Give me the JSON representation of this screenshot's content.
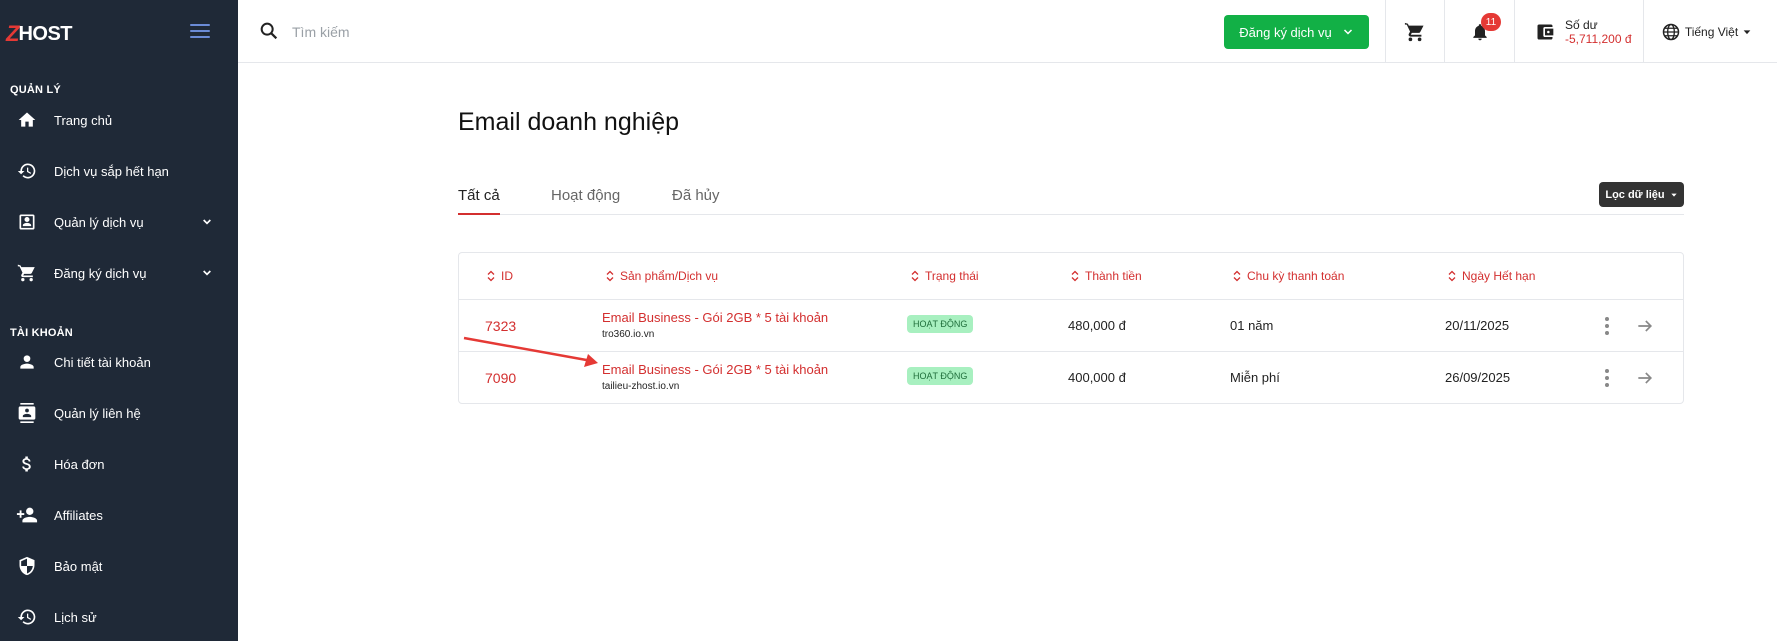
{
  "brand": {
    "z": "Z",
    "name": "HOST"
  },
  "sidebar": {
    "section_manage": "QUẢN LÝ",
    "section_account": "TÀI KHOẢN",
    "items": [
      {
        "label": "Trang chủ",
        "icon": "home-icon"
      },
      {
        "label": "Dịch vụ sắp hết hạn",
        "icon": "history-icon"
      },
      {
        "label": "Quản lý dịch vụ",
        "icon": "account-box-icon"
      },
      {
        "label": "Đăng ký dịch vụ",
        "icon": "cart-icon"
      },
      {
        "label": "Chi tiết tài khoản",
        "icon": "person-icon"
      },
      {
        "label": "Quản lý liên hệ",
        "icon": "contacts-icon"
      },
      {
        "label": "Hóa đơn",
        "icon": "dollar-icon"
      },
      {
        "label": "Affiliates",
        "icon": "person-add-icon"
      },
      {
        "label": "Bảo mật",
        "icon": "shield-icon"
      },
      {
        "label": "Lịch sử",
        "icon": "history-icon"
      }
    ]
  },
  "topbar": {
    "search_placeholder": "Tìm kiếm",
    "register_label": "Đăng ký dịch vụ",
    "notification_count": "11",
    "balance_label": "Số dư",
    "balance_value": "-5,711,200 đ",
    "language": "Tiếng Việt"
  },
  "page": {
    "title": "Email doanh nghiệp",
    "tabs": [
      "Tất cả",
      "Hoạt động",
      "Đã hủy"
    ],
    "filter_label": "Lọc dữ liệu"
  },
  "table": {
    "headers": [
      "ID",
      "Sản phẩm/Dịch vụ",
      "Trạng thái",
      "Thành tiền",
      "Chu kỳ thanh toán",
      "Ngày Hết hạn"
    ],
    "rows": [
      {
        "id": "7323",
        "product": "Email Business - Gói 2GB * 5 tài khoản",
        "domain": "tro360.io.vn",
        "status": "HOẠT ĐỘNG",
        "amount": "480,000 đ",
        "cycle": "01 năm",
        "expiry": "20/11/2025"
      },
      {
        "id": "7090",
        "product": "Email Business - Gói 2GB * 5 tài khoản",
        "domain": "tailieu-zhost.io.vn",
        "status": "HOẠT ĐỘNG",
        "amount": "400,000 đ",
        "cycle": "Miễn phí",
        "expiry": "26/09/2025"
      }
    ]
  },
  "colors": {
    "sidebar_bg": "#1f2937",
    "accent_red": "#d32f2f",
    "register_green": "#12b046",
    "status_bg": "#a8f0c0"
  }
}
